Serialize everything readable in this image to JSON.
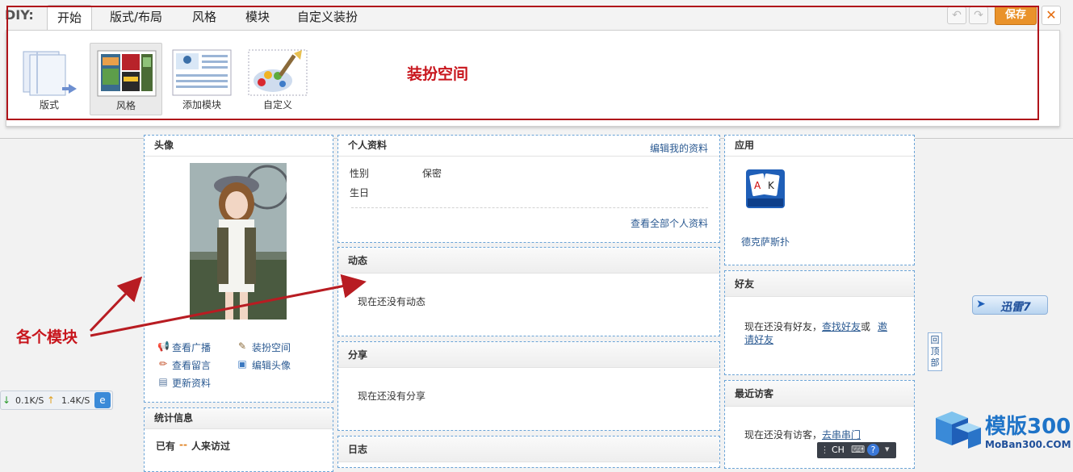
{
  "diy": {
    "label": "DIY:",
    "tabs": [
      "开始",
      "版式/布局",
      "风格",
      "模块",
      "自定义装扮"
    ],
    "tools": [
      {
        "label": "版式",
        "icon": "layout-icon"
      },
      {
        "label": "风格",
        "icon": "style-icon"
      },
      {
        "label": "添加模块",
        "icon": "add-module-icon"
      },
      {
        "label": "自定义",
        "icon": "palette-icon"
      }
    ],
    "save": "保存",
    "undo": "↶",
    "redo": "↷",
    "close": "✕",
    "space_annotation": "装扮空间"
  },
  "avatar_block": {
    "title": "头像",
    "actions": [
      "查看广播",
      "装扮空间",
      "查看留言",
      "编辑头像",
      "更新资料"
    ]
  },
  "stats_block": {
    "title": "统计信息",
    "visits_prefix": "已有",
    "visits_count": "--",
    "visits_suffix": "人来访过"
  },
  "profile_block": {
    "title": "个人资料",
    "edit_link": "编辑我的资料",
    "gender_label": "性别",
    "gender_value": "保密",
    "birthday_label": "生日",
    "view_all": "查看全部个人资料"
  },
  "feed_block": {
    "title": "动态",
    "empty": "现在还没有动态"
  },
  "share_block": {
    "title": "分享",
    "empty": "现在还没有分享"
  },
  "blog_block": {
    "title": "日志"
  },
  "apps_block": {
    "title": "应用",
    "app_name": "德克萨斯扑"
  },
  "friends_block": {
    "title": "好友",
    "empty_prefix": "现在还没有好友，",
    "find_link": "查找好友",
    "or": " 或 ",
    "invite_link_1": "邀",
    "invite_link_2": "请好友"
  },
  "visitors_block": {
    "title": "最近访客",
    "empty_prefix": "现在还没有访客，",
    "link": "去串串门"
  },
  "annotation": {
    "modules": "各个模块"
  },
  "speed_widget": {
    "down": "0.1K/S",
    "up": "1.4K/S"
  },
  "xunlei": {
    "label": "迅雷7"
  },
  "back_top": {
    "label": "回顶部"
  },
  "watermark": {
    "main": "模版300",
    "sub": "MoBan300.COM"
  },
  "tray": {
    "lang": "CH"
  },
  "colors": {
    "accent_red": "#c8161d",
    "save_orange": "#e9922a",
    "dashed_blue": "#6aa3d6",
    "link_blue": "#2b5a92"
  }
}
